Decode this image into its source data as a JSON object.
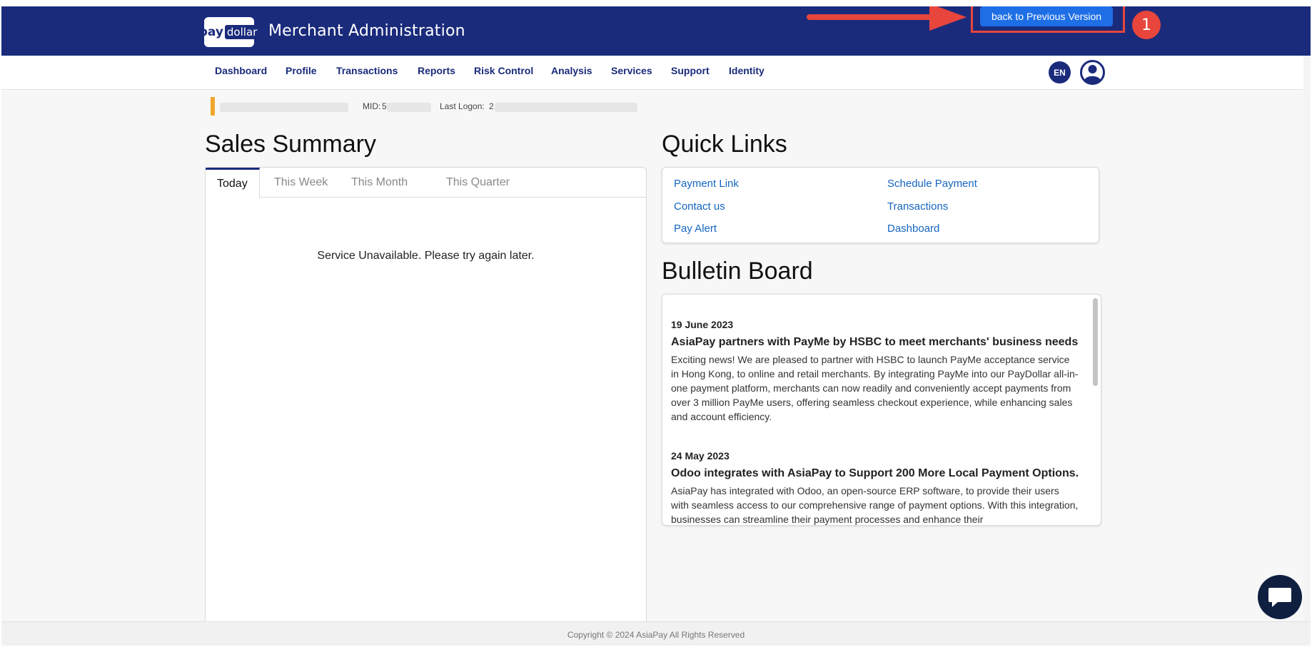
{
  "header": {
    "logo_pay": "pay",
    "logo_dollar": "dollar",
    "title": "Merchant Administration",
    "back_button": "back to Previous Version",
    "step_badge": "1"
  },
  "nav": {
    "items": [
      "Dashboard",
      "Profile",
      "Transactions",
      "Reports",
      "Risk Control",
      "Analysis",
      "Services",
      "Support",
      "Identity"
    ],
    "language": "EN"
  },
  "merchant_info": {
    "mid_label": "MID:",
    "mid_value_visible": "5",
    "last_logon_label": "Last Logon:",
    "last_logon_value_visible": "2"
  },
  "sales_summary": {
    "title": "Sales Summary",
    "tabs": [
      "Today",
      "This Week",
      "This Month",
      "This Quarter"
    ],
    "active_tab": "Today",
    "message": "Service Unavailable. Please try again later."
  },
  "quick_links": {
    "title": "Quick Links",
    "links": [
      "Payment Link",
      "Schedule Payment",
      "Contact us",
      "Transactions",
      "Pay Alert",
      "Dashboard"
    ]
  },
  "bulletin_board": {
    "title": "Bulletin Board",
    "items": [
      {
        "date": "19 June 2023",
        "headline": "AsiaPay partners with PayMe by HSBC to meet merchants' business needs",
        "body": "Exciting news! We are pleased to partner with HSBC to launch PayMe acceptance service in Hong Kong, to online and retail merchants. By integrating PayMe into our PayDollar all-in-one payment platform, merchants can now readily and conveniently accept payments from over 3 million PayMe users, offering seamless checkout experience, while enhancing sales and account efficiency."
      },
      {
        "date": "24 May 2023",
        "headline": "Odoo integrates with AsiaPay to Support 200 More Local Payment Options.",
        "body": "AsiaPay has integrated with Odoo, an open-source ERP software, to provide their users with seamless access to our comprehensive range of payment options. With this integration, businesses can streamline their payment processes and enhance their"
      }
    ]
  },
  "footer": {
    "copyright": "Copyright © 2024 AsiaPay All Rights Reserved"
  },
  "colors": {
    "header_bg": "#1a2b7c",
    "accent_blue": "#1e6fe6",
    "link_blue": "#1565c0",
    "annotation_red": "#e8453c",
    "info_bar_orange": "#f0a72c"
  },
  "icons": {
    "user": "user-circle-icon",
    "chat": "chat-bubble-icon",
    "arrow": "arrow-right-icon"
  }
}
